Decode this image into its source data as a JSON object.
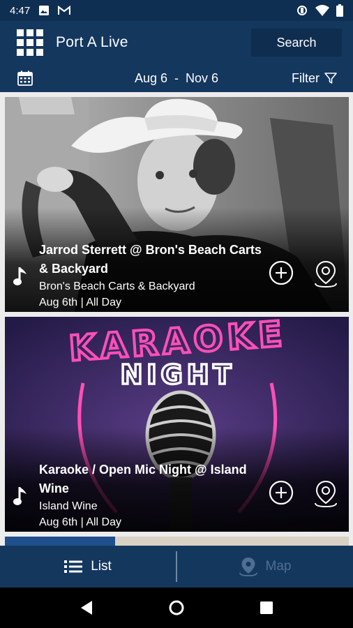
{
  "status_bar": {
    "time": "4:47",
    "icons": [
      "image-icon",
      "gmail-icon",
      "vibrate-icon",
      "wifi-icon",
      "battery-icon"
    ]
  },
  "app_bar": {
    "menu_icon": "grid-menu-icon",
    "title": "Port A Live",
    "search_label": "Search"
  },
  "date_bar": {
    "calendar_icon": "calendar-icon",
    "start": "Aug 6",
    "separator": "-",
    "end": "Nov 6",
    "filter_label": "Filter",
    "filter_icon": "funnel-icon"
  },
  "events": [
    {
      "title": "Jarrod Sterrett @ Bron's Beach Carts & Backyard",
      "venue": "Bron's Beach Carts & Backyard",
      "when": "Aug 6th | All Day",
      "category_icon": "music-note-icon"
    },
    {
      "title": "Karaoke / Open Mic Night @ Island Wine",
      "venue": "Island Wine",
      "when": "Aug 6th | All Day",
      "category_icon": "music-note-icon",
      "art_text_1": "KARAOKE",
      "art_text_2": "NIGHT"
    }
  ],
  "tab_bar": {
    "tabs": [
      {
        "label": "List",
        "icon": "list-icon",
        "active": true
      },
      {
        "label": "Map",
        "icon": "map-pin-icon",
        "active": false
      }
    ]
  },
  "colors": {
    "primary": "#14375e",
    "status_bar": "#0f2f52",
    "neon_pink": "#ff4fb8",
    "inactive_tab": "#4f6f91"
  }
}
